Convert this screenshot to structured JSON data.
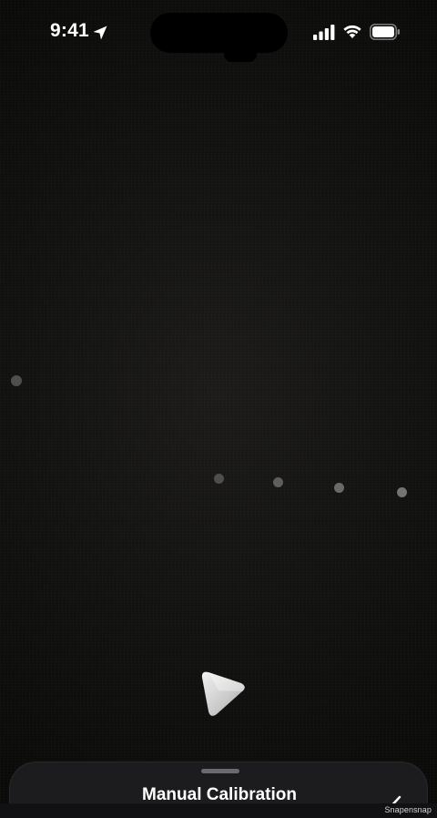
{
  "status_bar": {
    "time": "9:41",
    "icons": [
      "location-arrow-icon",
      "cellular-signal-icon",
      "wifi-icon",
      "battery-icon"
    ]
  },
  "calibration": {
    "pointer_icon": "triangle-pointer-icon",
    "dot_count": 5
  },
  "sheet": {
    "title": "Manual Calibration",
    "confirm_icon": "checkmark-icon",
    "background_color": "#1c1c1e"
  },
  "watermark": "Snapensnap",
  "colors": {
    "background": "#0b0b0a",
    "dots": "#5c5c5a",
    "text": "#ffffff"
  }
}
